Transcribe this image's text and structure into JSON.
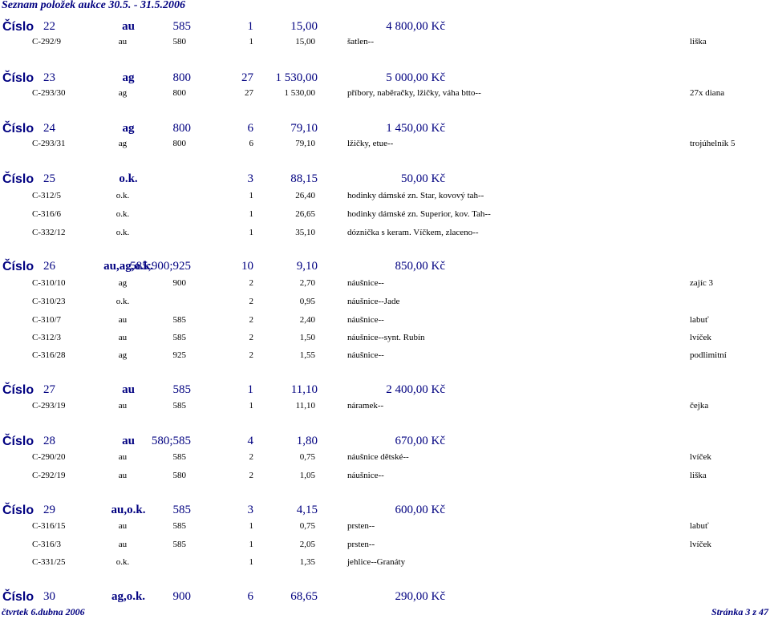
{
  "report_title": "Seznam položek aukce 30.5. - 31.5.2006",
  "lot_label": "Číslo",
  "lots": [
    {
      "number": "22",
      "metal": "au",
      "fineness": "585",
      "quantity": "1",
      "weight": "15,00",
      "price": "4 800,00 Kč",
      "items": [
        {
          "inventory": "C-292/9",
          "metal": "au",
          "fineness": "580",
          "quantity": "1",
          "weight": "15,00",
          "description": "šatlen--",
          "note": "liška"
        }
      ]
    },
    {
      "number": "23",
      "metal": "ag",
      "fineness": "800",
      "quantity": "27",
      "weight": "1 530,00",
      "price": "5 000,00 Kč",
      "items": [
        {
          "inventory": "C-293/30",
          "metal": "ag",
          "fineness": "800",
          "quantity": "27",
          "weight": "1 530,00",
          "description": "příbory, naběračky, lžičky, váha btto--",
          "note": "27x diana"
        }
      ]
    },
    {
      "number": "24",
      "metal": "ag",
      "fineness": "800",
      "quantity": "6",
      "weight": "79,10",
      "price": "1 450,00 Kč",
      "items": [
        {
          "inventory": "C-293/31",
          "metal": "ag",
          "fineness": "800",
          "quantity": "6",
          "weight": "79,10",
          "description": "lžičky, etue--",
          "note": "trojúhelník 5"
        }
      ]
    },
    {
      "number": "25",
      "metal": "o.k.",
      "fineness": "",
      "quantity": "3",
      "weight": "88,15",
      "price": "50,00 Kč",
      "items": [
        {
          "inventory": "C-312/5",
          "metal": "o.k.",
          "fineness": "",
          "quantity": "1",
          "weight": "26,40",
          "description": "hodinky dámské zn. Star, kovový tah--",
          "note": ""
        },
        {
          "inventory": "C-316/6",
          "metal": "o.k.",
          "fineness": "",
          "quantity": "1",
          "weight": "26,65",
          "description": "hodinky dámské zn. Superior, kov. Tah--",
          "note": ""
        },
        {
          "inventory": "C-332/12",
          "metal": "o.k.",
          "fineness": "",
          "quantity": "1",
          "weight": "35,10",
          "description": "dóznička s keram. Víčkem, zlaceno--",
          "note": ""
        }
      ]
    },
    {
      "number": "26",
      "metal": "au,ag,o.k.",
      "fineness": "585;900;925",
      "quantity": "10",
      "weight": "9,10",
      "price": "850,00 Kč",
      "items": [
        {
          "inventory": "C-310/10",
          "metal": "ag",
          "fineness": "900",
          "quantity": "2",
          "weight": "2,70",
          "description": "náušnice--",
          "note": "zajíc 3"
        },
        {
          "inventory": "C-310/23",
          "metal": "o.k.",
          "fineness": "",
          "quantity": "2",
          "weight": "0,95",
          "description": "náušnice--Jade",
          "note": ""
        },
        {
          "inventory": "C-310/7",
          "metal": "au",
          "fineness": "585",
          "quantity": "2",
          "weight": "2,40",
          "description": "náušnice--",
          "note": "labuť"
        },
        {
          "inventory": "C-312/3",
          "metal": "au",
          "fineness": "585",
          "quantity": "2",
          "weight": "1,50",
          "description": "náušnice--synt. Rubín",
          "note": "lvíček"
        },
        {
          "inventory": "C-316/28",
          "metal": "ag",
          "fineness": "925",
          "quantity": "2",
          "weight": "1,55",
          "description": "náušnice--",
          "note": "podlimitní"
        }
      ]
    },
    {
      "number": "27",
      "metal": "au",
      "fineness": "585",
      "quantity": "1",
      "weight": "11,10",
      "price": "2 400,00 Kč",
      "items": [
        {
          "inventory": "C-293/19",
          "metal": "au",
          "fineness": "585",
          "quantity": "1",
          "weight": "11,10",
          "description": "náramek--",
          "note": "čejka"
        }
      ]
    },
    {
      "number": "28",
      "metal": "au",
      "fineness": "580;585",
      "quantity": "4",
      "weight": "1,80",
      "price": "670,00 Kč",
      "items": [
        {
          "inventory": "C-290/20",
          "metal": "au",
          "fineness": "585",
          "quantity": "2",
          "weight": "0,75",
          "description": "náušnice dětské--",
          "note": "lvíček"
        },
        {
          "inventory": "C-292/19",
          "metal": "au",
          "fineness": "580",
          "quantity": "2",
          "weight": "1,05",
          "description": "náušnice--",
          "note": "liška"
        }
      ]
    },
    {
      "number": "29",
      "metal": "au,o.k.",
      "fineness": "585",
      "quantity": "3",
      "weight": "4,15",
      "price": "600,00 Kč",
      "items": [
        {
          "inventory": "C-316/15",
          "metal": "au",
          "fineness": "585",
          "quantity": "1",
          "weight": "0,75",
          "description": "prsten--",
          "note": "labuť"
        },
        {
          "inventory": "C-316/3",
          "metal": "au",
          "fineness": "585",
          "quantity": "1",
          "weight": "2,05",
          "description": "prsten--",
          "note": "lvíček"
        },
        {
          "inventory": "C-331/25",
          "metal": "o.k.",
          "fineness": "",
          "quantity": "1",
          "weight": "1,35",
          "description": "jehlice--Granáty",
          "note": ""
        }
      ]
    },
    {
      "number": "30",
      "metal": "ag,o.k.",
      "fineness": "900",
      "quantity": "6",
      "weight": "68,65",
      "price": "290,00 Kč",
      "items": []
    }
  ],
  "footer": {
    "date": "čtvrtek 6.dubna 2006",
    "page": "Stránka 3 z 47"
  }
}
